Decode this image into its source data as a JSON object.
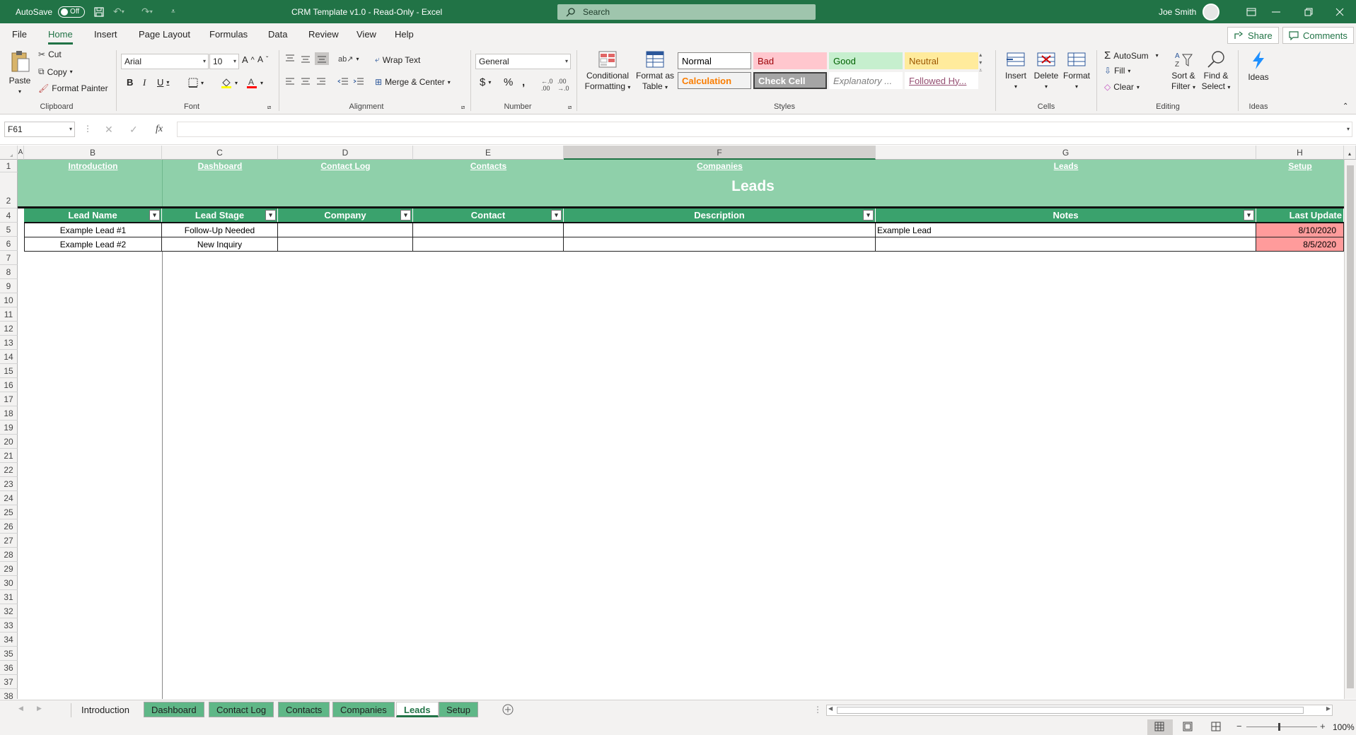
{
  "titlebar": {
    "autosave_label": "AutoSave",
    "autosave_state": "Off",
    "doc_title": "CRM Template v1.0  -  Read-Only  -  Excel",
    "search_placeholder": "Search",
    "user_name": "Joe Smith"
  },
  "menu": {
    "tabs": [
      "File",
      "Home",
      "Insert",
      "Page Layout",
      "Formulas",
      "Data",
      "Review",
      "View",
      "Help"
    ],
    "active": "Home",
    "share_label": "Share",
    "comments_label": "Comments"
  },
  "ribbon": {
    "clipboard": {
      "paste": "Paste",
      "cut": "Cut",
      "copy": "Copy",
      "format_painter": "Format Painter",
      "label": "Clipboard"
    },
    "font": {
      "name": "Arial",
      "size": "10",
      "label": "Font"
    },
    "alignment": {
      "wrap_text": "Wrap Text",
      "merge_center": "Merge & Center",
      "label": "Alignment"
    },
    "number": {
      "format": "General",
      "label": "Number"
    },
    "styles": {
      "conditional": "Conditional",
      "formatting": "Formatting",
      "format_as": "Format as",
      "table": "Table",
      "cells": [
        {
          "label": "Normal",
          "bg": "#ffffff",
          "fg": "#000000",
          "border": "#8a8886"
        },
        {
          "label": "Bad",
          "bg": "#ffc7ce",
          "fg": "#9c0006",
          "border": "#ffc7ce"
        },
        {
          "label": "Good",
          "bg": "#c6efce",
          "fg": "#006100",
          "border": "#c6efce"
        },
        {
          "label": "Neutral",
          "bg": "#ffeb9c",
          "fg": "#9c5700",
          "border": "#ffeb9c"
        },
        {
          "label": "Calculation",
          "bg": "#f2f2f2",
          "fg": "#fa7d00",
          "border": "#7f7f7f"
        },
        {
          "label": "Check Cell",
          "bg": "#a5a5a5",
          "fg": "#ffffff",
          "border": "#3f3f3f"
        },
        {
          "label": "Explanatory ...",
          "bg": "#ffffff",
          "fg": "#7f7f7f",
          "border": "#ffffff"
        },
        {
          "label": "Followed Hy...",
          "bg": "#ffffff",
          "fg": "#954f72",
          "border": "#ffffff"
        }
      ],
      "label": "Styles"
    },
    "cells": {
      "insert": "Insert",
      "delete": "Delete",
      "format": "Format",
      "label": "Cells"
    },
    "editing": {
      "autosum": "AutoSum",
      "fill": "Fill",
      "clear": "Clear",
      "sort1": "Sort &",
      "sort2": "Filter",
      "find1": "Find &",
      "find2": "Select",
      "label": "Editing"
    },
    "ideas": {
      "button": "Ideas",
      "label": "Ideas"
    }
  },
  "formula_bar": {
    "name_box": "F61",
    "fx": "fx",
    "value": ""
  },
  "sheet": {
    "columns": [
      "A",
      "B",
      "C",
      "D",
      "E",
      "F",
      "G",
      "H"
    ],
    "selected_column": "F",
    "nav_links": [
      "Introduction",
      "Dashboard",
      "Contact Log",
      "Contacts",
      "Companies",
      "Leads",
      "Setup"
    ],
    "title": "Leads",
    "headers": [
      "Lead Name",
      "Lead Stage",
      "Company",
      "Contact",
      "Description",
      "Notes",
      "Last Update"
    ],
    "rows": [
      {
        "lead_name": "Example Lead #1",
        "lead_stage": "Follow-Up Needed",
        "company": "",
        "contact": "",
        "description": "",
        "notes": "Example Lead",
        "last_update": "8/10/2020"
      },
      {
        "lead_name": "Example Lead #2",
        "lead_stage": "New Inquiry",
        "company": "",
        "contact": "",
        "description": "",
        "notes": "",
        "last_update": "8/5/2020"
      }
    ],
    "row_numbers": [
      "1",
      "2",
      "4",
      "5",
      "6",
      "7",
      "8",
      "9",
      "10",
      "11",
      "12",
      "13",
      "14",
      "15",
      "16",
      "17",
      "18",
      "19",
      "20",
      "21",
      "22",
      "23",
      "24",
      "25",
      "26",
      "27",
      "28",
      "29",
      "30",
      "31",
      "32",
      "33",
      "34",
      "35",
      "36",
      "37",
      "38"
    ],
    "header_color": "#3aa26d",
    "banner_color": "#8fd0aa",
    "date_highlight": "#ff9b9b"
  },
  "sheet_tabs": [
    {
      "label": "Introduction",
      "style": "plain"
    },
    {
      "label": "Dashboard",
      "style": "green"
    },
    {
      "label": "Contact Log",
      "style": "green"
    },
    {
      "label": "Contacts",
      "style": "green"
    },
    {
      "label": "Companies",
      "style": "green"
    },
    {
      "label": "Leads",
      "style": "active"
    },
    {
      "label": "Setup",
      "style": "green"
    }
  ],
  "status": {
    "zoom": "100%"
  }
}
